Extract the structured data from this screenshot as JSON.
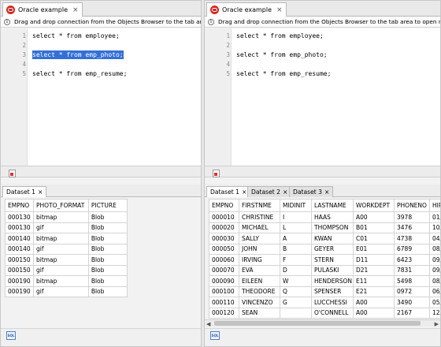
{
  "left": {
    "doc_tab": "Oracle example",
    "info": "Drag and drop connection from the Objects Browser to the tab area to open new SQL Editor",
    "lines": [
      {
        "n": "1",
        "text": "select * from employee;",
        "selected": false
      },
      {
        "n": "2",
        "text": "",
        "selected": false
      },
      {
        "n": "3",
        "text": "select * from emp_photo;",
        "selected": true
      },
      {
        "n": "4",
        "text": "",
        "selected": false
      },
      {
        "n": "5",
        "text": "select * from emp_resume;",
        "selected": false
      }
    ],
    "result_tabs": [
      "Dataset 1"
    ],
    "columns": [
      "EMPNO",
      "PHOTO_FORMAT",
      "PICTURE"
    ],
    "rows": [
      [
        "000130",
        "bitmap",
        "Blob"
      ],
      [
        "000130",
        "gif",
        "Blob"
      ],
      [
        "000140",
        "bitmap",
        "Blob"
      ],
      [
        "000140",
        "gif",
        "Blob"
      ],
      [
        "000150",
        "bitmap",
        "Blob"
      ],
      [
        "000150",
        "gif",
        "Blob"
      ],
      [
        "000190",
        "bitmap",
        "Blob"
      ],
      [
        "000190",
        "gif",
        "Blob"
      ]
    ]
  },
  "right": {
    "doc_tab": "Oracle example",
    "info": "Drag and drop connection from the Objects Browser to the tab area to open new SQL Editor",
    "lines": [
      {
        "n": "1",
        "text": "select * from employee;"
      },
      {
        "n": "2",
        "text": ""
      },
      {
        "n": "3",
        "text": "select * from emp_photo;"
      },
      {
        "n": "4",
        "text": ""
      },
      {
        "n": "5",
        "text": "select * from emp_resume;"
      }
    ],
    "result_tabs": [
      "Dataset 1",
      "Dataset 2",
      "Dataset 3"
    ],
    "columns": [
      "EMPNO",
      "FIRSTNME",
      "MIDINIT",
      "LASTNAME",
      "WORKDEPT",
      "PHONENO",
      "HIR"
    ],
    "rows": [
      [
        "000010",
        "CHRISTINE",
        "I",
        "HAAS",
        "A00",
        "3978",
        "01/0"
      ],
      [
        "000020",
        "MICHAEL",
        "L",
        "THOMPSON",
        "B01",
        "3476",
        "10/"
      ],
      [
        "000030",
        "SALLY",
        "A",
        "KWAN",
        "C01",
        "4738",
        "04/0"
      ],
      [
        "000050",
        "JOHN",
        "B",
        "GEYER",
        "E01",
        "6789",
        "08/"
      ],
      [
        "000060",
        "IRVING",
        "F",
        "STERN",
        "D11",
        "6423",
        "09/"
      ],
      [
        "000070",
        "EVA",
        "D",
        "PULASKI",
        "D21",
        "7831",
        "09/3"
      ],
      [
        "000090",
        "EILEEN",
        "W",
        "HENDERSON",
        "E11",
        "5498",
        "08/"
      ],
      [
        "000100",
        "THEODORE",
        "Q",
        "SPENSER",
        "E21",
        "0972",
        "06/"
      ],
      [
        "000110",
        "VINCENZO",
        "G",
        "LUCCHESSI",
        "A00",
        "3490",
        "05/"
      ],
      [
        "000120",
        "SEAN",
        "",
        "O'CONNELL",
        "A00",
        "2167",
        "12/0"
      ]
    ]
  },
  "colors": {
    "selection": "#3370d6",
    "oracle_icon": "#d9271f"
  },
  "icons": {
    "tab": "oracle-icon",
    "info": "info-icon",
    "close": "close-icon",
    "run": "execute-icon",
    "status": "sql-icon"
  }
}
